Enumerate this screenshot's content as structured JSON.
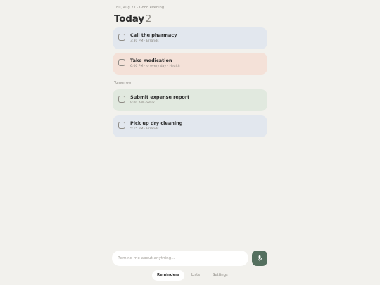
{
  "header": {
    "date_line": "Thu, Aug 27 · Good evening",
    "title": "Today",
    "count": "2"
  },
  "today": {
    "items": [
      {
        "title": "Call the pharmacy",
        "meta": "3:30 PM · Errands",
        "color": "#e2e7ee"
      },
      {
        "title": "Take medication",
        "meta": "6:00 PM · ↻ every day · Health",
        "color": "#f4e1d8"
      }
    ]
  },
  "tomorrow": {
    "label": "Tomorrow",
    "items": [
      {
        "title": "Submit expense report",
        "meta": "9:00 AM · Work",
        "color": "#e1e9df"
      },
      {
        "title": "Pick up dry cleaning",
        "meta": "5:15 PM · Errands",
        "color": "#e2e7ee"
      }
    ]
  },
  "composer": {
    "placeholder": "Remind me about anything...",
    "value": ""
  },
  "mic_button": {
    "icon": "microphone-icon",
    "color": "#55705f"
  },
  "nav": {
    "items": [
      {
        "label": "Reminders",
        "active": true
      },
      {
        "label": "Lists",
        "active": false
      },
      {
        "label": "Settings",
        "active": false
      }
    ]
  }
}
